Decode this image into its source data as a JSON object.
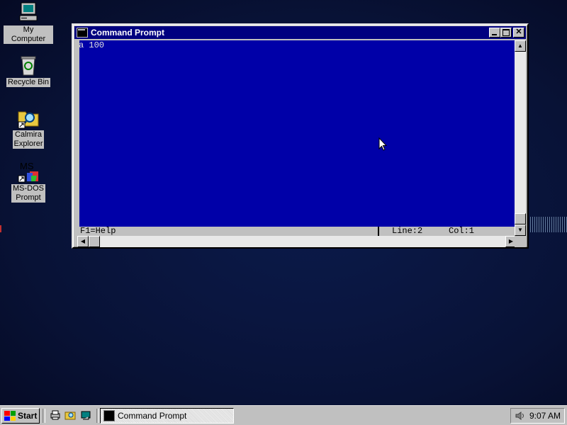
{
  "desktop": {
    "icons": [
      {
        "label": "My Computer"
      },
      {
        "label": "Recycle Bin"
      },
      {
        "label_line1": "Calmira",
        "label_line2": "Explorer"
      },
      {
        "label_line1": "MS-DOS",
        "label_line2": "Prompt",
        "glyph": "MS"
      }
    ]
  },
  "window": {
    "title": "Command Prompt",
    "content_text": "a 100",
    "status": {
      "help": "F1=Help",
      "line": "Line:2",
      "col": "Col:1"
    }
  },
  "taskbar": {
    "start_label": "Start",
    "task_label": "Command Prompt",
    "clock": "9:07 AM"
  },
  "colors": {
    "title_bar": "#000080",
    "dos_background": "#0000a8",
    "chrome": "#c0c0c0"
  }
}
